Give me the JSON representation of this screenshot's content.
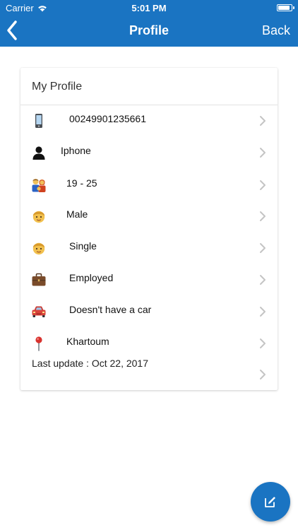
{
  "status_bar": {
    "carrier": "Carrier",
    "time": "5:01 PM",
    "wifi_icon": "wifi-icon",
    "battery_icon": "battery-icon"
  },
  "nav": {
    "title": "Profile",
    "back_label": "Back",
    "back_icon": "chevron-left-icon",
    "color": "#1a74c2"
  },
  "card": {
    "title": "My Profile",
    "rows": [
      {
        "icon": "mobile-phone-icon",
        "label": "00249901235661"
      },
      {
        "icon": "user-silhouette-icon",
        "label": "Iphone"
      },
      {
        "icon": "family-icon",
        "label": "19 - 25"
      },
      {
        "icon": "man-face-icon",
        "label": "Male"
      },
      {
        "icon": "man-face-icon",
        "label": "Single"
      },
      {
        "icon": "briefcase-icon",
        "label": "Employed"
      },
      {
        "icon": "car-icon",
        "label": "Doesn't have a car"
      },
      {
        "icon": "location-pin-icon",
        "label": "Khartoum"
      }
    ],
    "last_update": "Last update : Oct 22, 2017"
  },
  "fab": {
    "icon": "edit-icon",
    "color": "#1a74c2"
  }
}
